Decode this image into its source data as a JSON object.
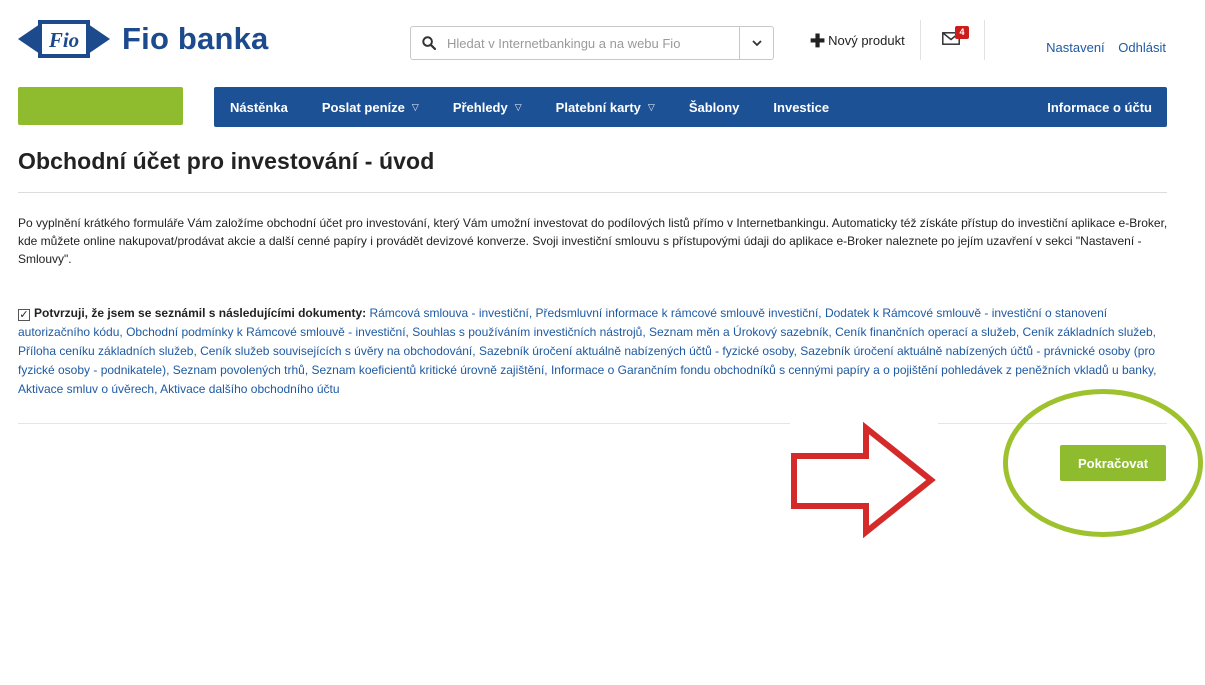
{
  "brand": {
    "name": "Fio banka",
    "logo_text": "Fio"
  },
  "search": {
    "placeholder": "Hledat v Internetbankingu a na webu Fio"
  },
  "header": {
    "new_product_label": "Nový produkt",
    "mail_badge": "4",
    "settings_label": "Nastavení",
    "logout_label": "Odhlásit"
  },
  "nav": {
    "items": [
      {
        "label": "Nástěnka"
      },
      {
        "label": "Poslat peníze"
      },
      {
        "label": "Přehledy"
      },
      {
        "label": "Platební karty"
      },
      {
        "label": "Šablony"
      },
      {
        "label": "Investice"
      }
    ],
    "account_info_label": "Informace o účtu"
  },
  "main": {
    "title": "Obchodní účet pro investování - úvod",
    "intro": "Po vyplnění krátkého formuláře Vám založíme obchodní účet pro investování, který Vám umožní investovat do podílových listů přímo v Internetbankingu. Automaticky též získáte přístup do investiční aplikace e-Broker, kde můžete online nakupovat/prodávat akcie a další cenné papíry i provádět devizové konverze. Svoji investiční smlouvu s přístupovými údaji do aplikace e-Broker naleznete po jejím uzavření v sekci \"Nastavení - Smlouvy\".",
    "checkbox_checked": true,
    "confirm_label": "Potvrzuji, že jsem se seznámil s následujícími dokumenty:",
    "documents": [
      "Rámcová smlouva - investiční",
      "Předsmluvní informace k rámcové smlouvě investiční",
      "Dodatek k Rámcové smlouvě - investiční o stanovení autorizačního kódu",
      "Obchodní podmínky k Rámcové smlouvě - investiční",
      "Souhlas s používáním investičních nástrojů",
      "Seznam měn a Úrokový sazebník",
      "Ceník finančních operací a služeb",
      "Ceník základních služeb",
      "Příloha ceníku základních služeb",
      "Ceník služeb souvisejících s úvěry na obchodování",
      "Sazebník úročení aktuálně nabízených účtů - fyzické osoby",
      "Sazebník úročení aktuálně nabízených účtů - právnické osoby (pro fyzické osoby - podnikatele)",
      "Seznam povolených trhů",
      "Seznam koeficientů kritické úrovně zajištění",
      "Informace o Garančním fondu obchodníků s cennými papíry a o pojištění pohledávek z peněžních vkladů u banky",
      "Aktivace smluv o úvěrech",
      "Aktivace dalšího obchodního účtu"
    ],
    "continue_label": "Pokračovat"
  },
  "colors": {
    "brand_blue": "#1d4a8c",
    "nav_blue": "#1d5196",
    "link_blue": "#1e5aa3",
    "accent_green": "#8fbc2f",
    "annotation_red": "#d42a2a",
    "annotation_green": "#9ec22e"
  }
}
